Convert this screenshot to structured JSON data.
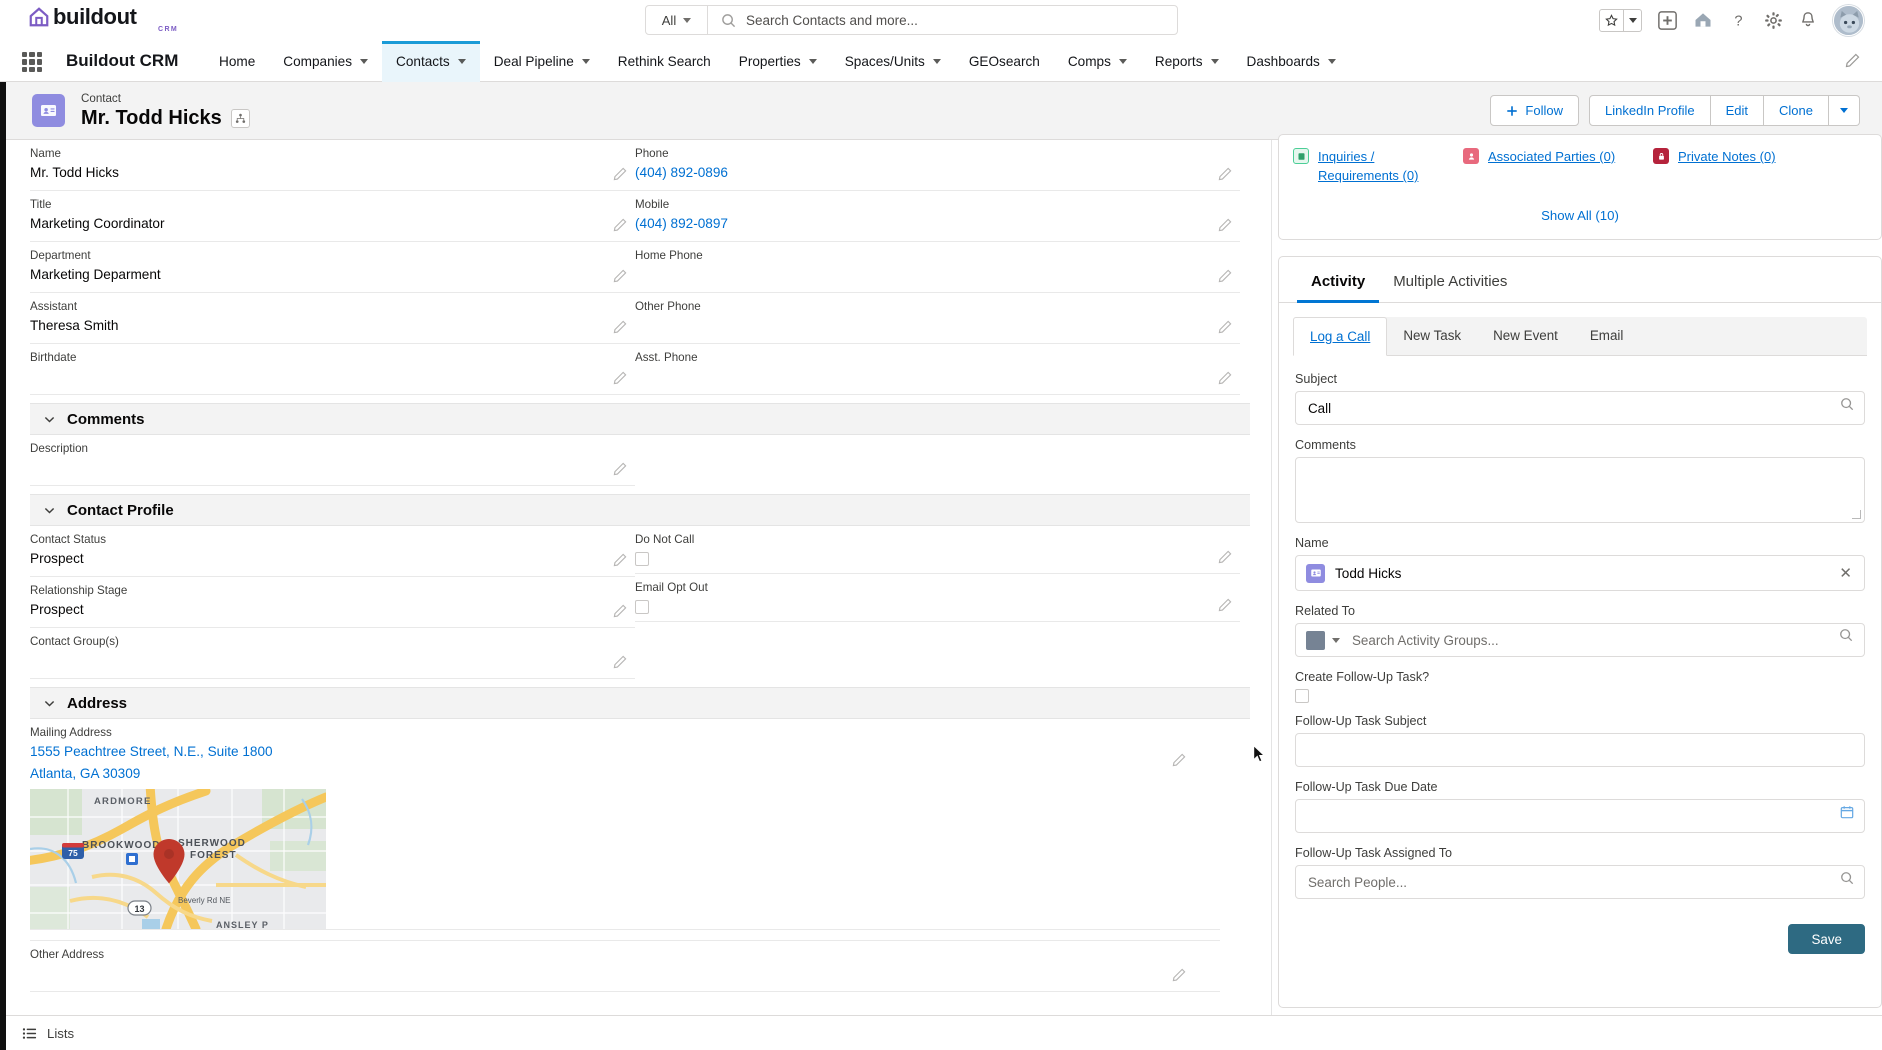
{
  "brand": {
    "logo_text": "buildout",
    "logo_sub": "CRM",
    "accent": "#7c5cc4",
    "nav_active_color": "#1a9bd7",
    "link_color": "#0070d2",
    "save_color": "#2e6a82"
  },
  "global_header": {
    "search": {
      "scope": "All",
      "placeholder": "Search Contacts and more..."
    },
    "icons": [
      "star-icon",
      "chevron-down-icon",
      "add-icon",
      "buildout-home-icon",
      "help-icon",
      "gear-icon",
      "bell-icon",
      "avatar"
    ]
  },
  "nav": {
    "app_name": "Buildout CRM",
    "items": [
      {
        "label": "Home",
        "has_caret": false,
        "active": false
      },
      {
        "label": "Companies",
        "has_caret": true,
        "active": false
      },
      {
        "label": "Contacts",
        "has_caret": true,
        "active": true
      },
      {
        "label": "Deal Pipeline",
        "has_caret": true,
        "active": false
      },
      {
        "label": "Rethink Search",
        "has_caret": false,
        "active": false
      },
      {
        "label": "Properties",
        "has_caret": true,
        "active": false
      },
      {
        "label": "Spaces/Units",
        "has_caret": true,
        "active": false
      },
      {
        "label": "GEOsearch",
        "has_caret": false,
        "active": false
      },
      {
        "label": "Comps",
        "has_caret": true,
        "active": false
      },
      {
        "label": "Reports",
        "has_caret": true,
        "active": false
      },
      {
        "label": "Dashboards",
        "has_caret": true,
        "active": false
      }
    ]
  },
  "record_header": {
    "kicker": "Contact",
    "title": "Mr. Todd Hicks",
    "actions": {
      "follow": "Follow",
      "linkedin": "LinkedIn Profile",
      "edit": "Edit",
      "clone": "Clone"
    }
  },
  "detail": {
    "fields_top": [
      {
        "label": "Name",
        "value": "Mr. Todd Hicks",
        "type": "text"
      },
      {
        "label": "Phone",
        "value": "(404) 892-0896",
        "type": "link"
      },
      {
        "label": "Title",
        "value": "Marketing Coordinator",
        "type": "text"
      },
      {
        "label": "Mobile",
        "value": "(404) 892-0897",
        "type": "link"
      },
      {
        "label": "Department",
        "value": "Marketing Deparment",
        "type": "text"
      },
      {
        "label": "Home Phone",
        "value": "",
        "type": "text"
      },
      {
        "label": "Assistant",
        "value": "Theresa Smith",
        "type": "text"
      },
      {
        "label": "Other Phone",
        "value": "",
        "type": "text"
      },
      {
        "label": "Birthdate",
        "value": "",
        "type": "text"
      },
      {
        "label": "Asst. Phone",
        "value": "",
        "type": "text"
      }
    ],
    "comments_section": {
      "title": "Comments",
      "description_label": "Description",
      "description_value": ""
    },
    "contact_profile_section": {
      "title": "Contact Profile",
      "fields": [
        {
          "label": "Contact Status",
          "value": "Prospect",
          "type": "text"
        },
        {
          "label": "Do Not Call",
          "value": "",
          "type": "checkbox",
          "checked": false
        },
        {
          "label": "Relationship Stage",
          "value": "Prospect",
          "type": "text"
        },
        {
          "label": "Email Opt Out",
          "value": "",
          "type": "checkbox",
          "checked": false
        },
        {
          "label": "Contact Group(s)",
          "value": "",
          "type": "text"
        }
      ]
    },
    "address_section": {
      "title": "Address",
      "mailing_label": "Mailing Address",
      "mailing_line1": "1555 Peachtree Street, N.E., Suite 1800",
      "mailing_line2": "Atlanta, GA 30309",
      "other_label": "Other Address",
      "map": {
        "labels": [
          "ARDMORE",
          "BROOKWOOD",
          "SHERWOOD FOREST",
          "Beverly Rd NE",
          "ANSLEY"
        ],
        "shields": [
          "75",
          "13"
        ]
      }
    }
  },
  "related_lists": {
    "items": [
      {
        "label": "Inquiries / Requirements (0)",
        "icon": "inquiries-icon",
        "color": "#4bce97"
      },
      {
        "label": "Associated Parties (0)",
        "icon": "associated-parties-icon",
        "color": "#e8697d"
      },
      {
        "label": "Private Notes (0)",
        "icon": "lock-icon",
        "color": "#b5233c"
      }
    ],
    "show_all": "Show All (10)"
  },
  "activity": {
    "tabs": [
      {
        "label": "Activity",
        "active": true
      },
      {
        "label": "Multiple Activities",
        "active": false
      }
    ],
    "sub_tabs": [
      {
        "label": "Log a Call",
        "active": true
      },
      {
        "label": "New Task",
        "active": false
      },
      {
        "label": "New Event",
        "active": false
      },
      {
        "label": "Email",
        "active": false
      }
    ],
    "form": {
      "subject_label": "Subject",
      "subject_value": "Call",
      "comments_label": "Comments",
      "comments_value": "",
      "name_label": "Name",
      "name_value": "Todd Hicks",
      "related_to_label": "Related To",
      "related_to_placeholder": "Search Activity Groups...",
      "followup_checkbox_label": "Create Follow-Up Task?",
      "followup_checked": false,
      "followup_subject_label": "Follow-Up Task Subject",
      "followup_subject_value": "",
      "followup_due_label": "Follow-Up Task Due Date",
      "followup_due_value": "",
      "followup_assigned_label": "Follow-Up Task Assigned To",
      "followup_assigned_placeholder": "Search People...",
      "save_label": "Save"
    }
  },
  "footer": {
    "lists_label": "Lists"
  }
}
